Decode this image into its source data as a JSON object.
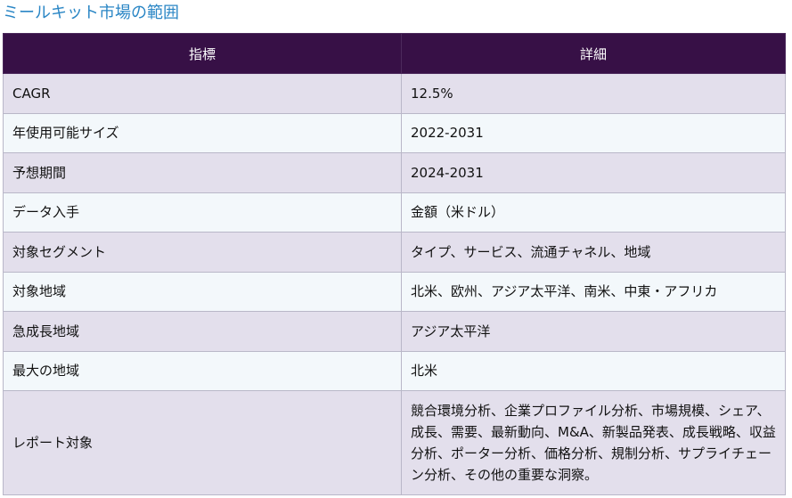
{
  "page": {
    "title": "ミールキット市場の範囲"
  },
  "table": {
    "headers": {
      "metric": "指標",
      "detail": "詳細"
    },
    "rows": [
      {
        "metric": "CAGR",
        "detail": "12.5%"
      },
      {
        "metric": "年使用可能サイズ",
        "detail": "2022-2031"
      },
      {
        "metric": "予想期間",
        "detail": "2024-2031"
      },
      {
        "metric": "データ入手",
        "detail": "金額（米ドル）"
      },
      {
        "metric": "対象セグメント",
        "detail": "タイプ、サービス、流通チャネル、地域"
      },
      {
        "metric": "対象地域",
        "detail": "北米、欧州、アジア太平洋、南米、中東・アフリカ"
      },
      {
        "metric": "急成長地域",
        "detail": "アジア太平洋"
      },
      {
        "metric": "最大の地域",
        "detail": "北米"
      },
      {
        "metric": "レポート対象",
        "detail": "競合環境分析、企業プロファイル分析、市場規模、シェア、成長、需要、最新動向、M&A、新製品発表、成長戦略、収益分析、ポーター分析、価格分析、規制分析、サプライチェーン分析、その他の重要な洞察。"
      }
    ]
  }
}
